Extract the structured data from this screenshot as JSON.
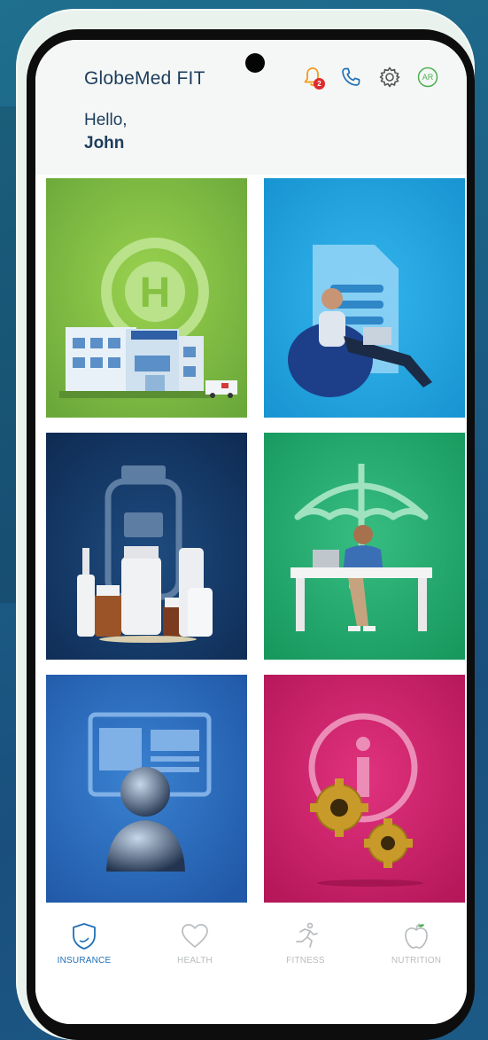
{
  "app": {
    "title": "GlobeMed FIT"
  },
  "header": {
    "greeting": "Hello,",
    "user_name": "John",
    "notification_count": "2",
    "language_label": "AR"
  },
  "tiles": [
    {
      "name": "hospital",
      "color": "#86c142"
    },
    {
      "name": "documents",
      "color": "#1ea6e3"
    },
    {
      "name": "medications",
      "color": "#123a66"
    },
    {
      "name": "coverage",
      "color": "#1fa56b"
    },
    {
      "name": "profile",
      "color": "#2b6fc2"
    },
    {
      "name": "info-settings",
      "color": "#d1206b"
    }
  ],
  "nav": {
    "items": [
      {
        "label": "INSURANCE",
        "icon": "shield-icon",
        "active": true
      },
      {
        "label": "HEALTH",
        "icon": "heart-icon",
        "active": false
      },
      {
        "label": "FITNESS",
        "icon": "runner-icon",
        "active": false
      },
      {
        "label": "NUTRITION",
        "icon": "apple-icon",
        "active": false
      }
    ]
  },
  "colors": {
    "primary_text": "#1d3d5c",
    "accent_blue": "#1f6fb6",
    "notification": "#f29a1a",
    "badge": "#e02b2b",
    "language": "#4caf50",
    "inactive": "#b8bcc0"
  }
}
